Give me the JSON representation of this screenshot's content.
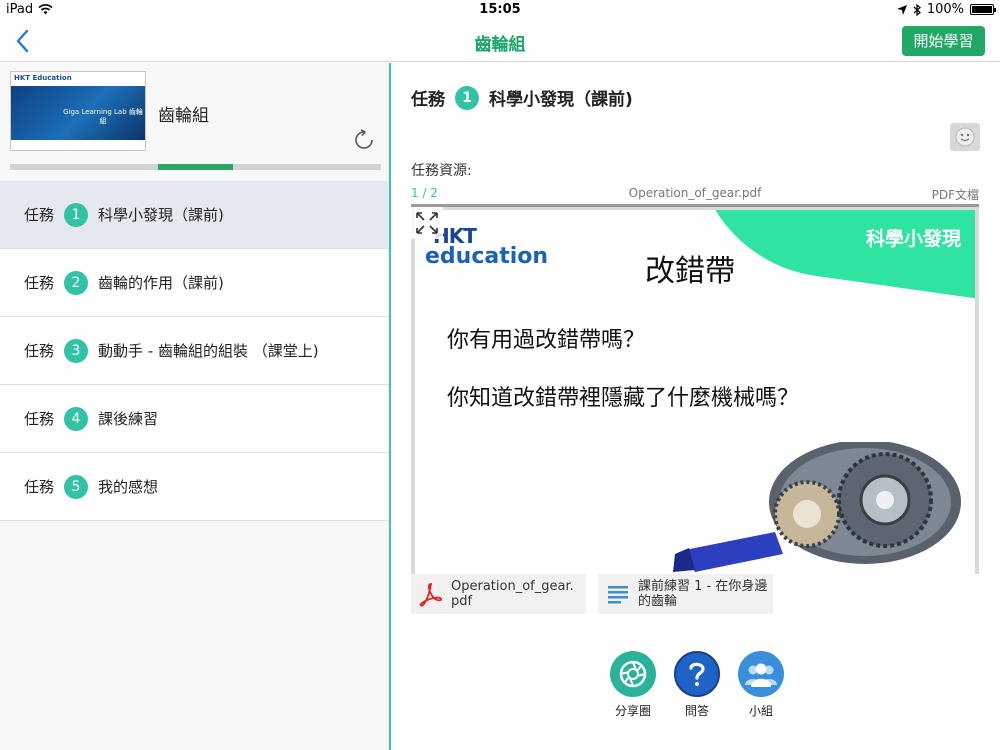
{
  "status_bar": {
    "device": "iPad",
    "time": "15:05",
    "battery": "100%"
  },
  "nav": {
    "title": "齒輪組",
    "start_label": "開始學習"
  },
  "course": {
    "name": "齒輪組",
    "thumb_logo": "HKT Education",
    "thumb_title": "Giga Learning Lab 齒輪組",
    "progress": 0.2
  },
  "tasks": [
    {
      "prefix": "任務",
      "num": "1",
      "name": "科學小發現（課前)"
    },
    {
      "prefix": "任務",
      "num": "2",
      "name": "齒輪的作用（課前)"
    },
    {
      "prefix": "任務",
      "num": "3",
      "name": "動動手 - 齒輪組的組裝 （課堂上)"
    },
    {
      "prefix": "任務",
      "num": "4",
      "name": "課後練習"
    },
    {
      "prefix": "任務",
      "num": "5",
      "name": "我的感想"
    }
  ],
  "detail": {
    "prefix": "任務",
    "num": "1",
    "title": "科學小發現（課前)",
    "resources_label": "任務資源:",
    "page": "1 / 2",
    "filename": "Operation_of_gear.pdf",
    "filetype": "PDF文檔",
    "slide": {
      "logo_top": "HKT",
      "logo_bottom": "education",
      "corner": "科學小發現",
      "title": "改錯帶",
      "q1": "你有用過改錯帶嗎？",
      "q2": "你知道改錯帶裡隱藏了什麼機械嗎？"
    },
    "attachments": [
      {
        "name": "Operation_of_gear.pdf",
        "icon": "pdf-icon"
      },
      {
        "name": "課前練習 1 - 在你身邊的齒輪",
        "icon": "document-icon"
      }
    ]
  },
  "actions": [
    {
      "label": "分享圈",
      "icon": "camera-aperture-icon",
      "color": "#2bb39a"
    },
    {
      "label": "問答",
      "icon": "question-icon",
      "color": "#1d64c6"
    },
    {
      "label": "小組",
      "icon": "group-icon",
      "color": "#3a8fdc"
    }
  ],
  "colors": {
    "accent": "#1aa56a",
    "task_number": "#32c3a6",
    "divider": "#37c5b2"
  }
}
